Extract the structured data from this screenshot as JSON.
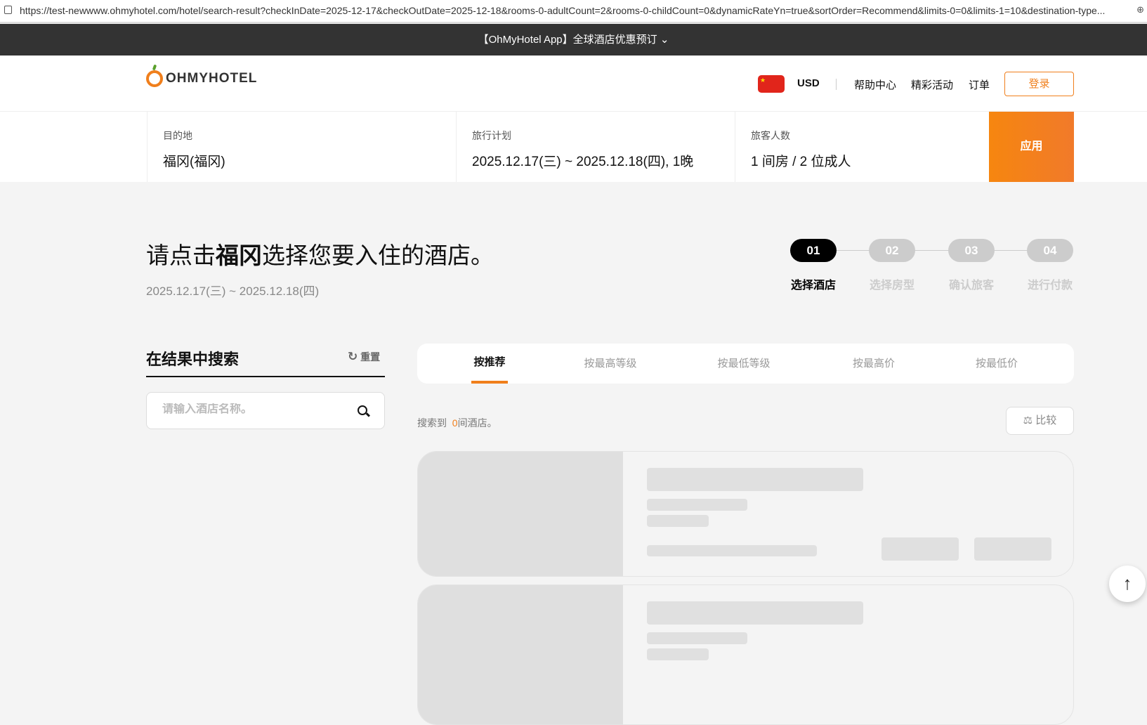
{
  "browser": {
    "url": "https://test-newwww.ohmyhotel.com/hotel/search-result?checkInDate=2025-12-17&checkOutDate=2025-12-18&rooms-0-adultCount=2&rooms-0-childCount=0&dynamicRateYn=true&sortOrder=Recommend&limits-0=0&limits-1=10&destination-type..."
  },
  "banner": {
    "text": "【OhMyHotel App】全球酒店优惠预订",
    "chevron": "⌄"
  },
  "header": {
    "logo": "OHMYHOTEL",
    "currency": "USD",
    "flag": "★",
    "nav": [
      "帮助中心",
      "精彩活动",
      "订单"
    ],
    "login": "登录"
  },
  "searchbar": {
    "destination": {
      "label": "目的地",
      "value": "福冈(福冈)"
    },
    "plan": {
      "label": "旅行计划",
      "value": "2025.12.17(三) ~ 2025.12.18(四), 1晚"
    },
    "guests": {
      "label": "旅客人数",
      "value": "1 间房 / 2 位成人"
    },
    "apply": "应用"
  },
  "main": {
    "title_pre": "请点击",
    "title_city": "福冈",
    "title_post": "选择您要入住的酒店。",
    "dates": "2025.12.17(三) ~ 2025.12.18(四)",
    "steps": [
      {
        "num": "01",
        "label": "选择酒店"
      },
      {
        "num": "02",
        "label": "选择房型"
      },
      {
        "num": "03",
        "label": "确认旅客"
      },
      {
        "num": "04",
        "label": "进行付款"
      }
    ]
  },
  "sidebar": {
    "title": "在结果中搜索",
    "reset": "重置",
    "reset_icon": "↻",
    "search_placeholder": "请输入酒店名称。"
  },
  "results": {
    "sort_tabs": [
      "按推荐",
      "按最高等级",
      "按最低等级",
      "按最高价",
      "按最低价"
    ],
    "count_pre": "搜索到",
    "count": "0",
    "count_post": "间酒店。",
    "compare": "比较",
    "compare_icon": "⚖"
  },
  "scroll_top_icon": "↑",
  "colors": {
    "accent": "#f07f1c",
    "dark": "#333333"
  }
}
